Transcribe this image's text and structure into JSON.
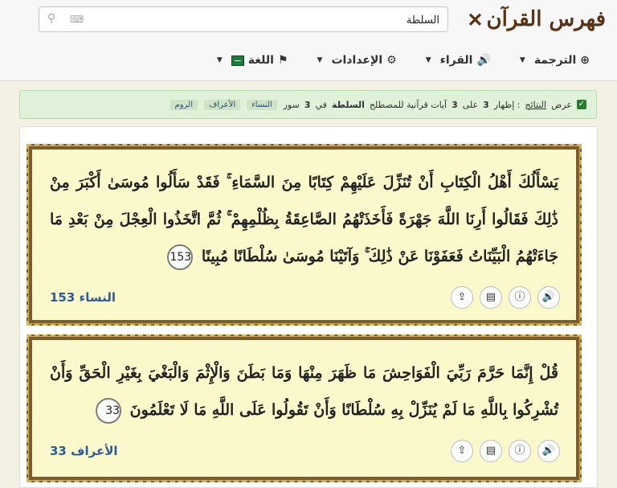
{
  "header": {
    "logo_text": "فهرس القرآن",
    "search_value": "السلطة"
  },
  "nav": [
    {
      "label": "الترجمة",
      "icon": "globe-icon"
    },
    {
      "label": "القراء",
      "icon": "speaker-icon"
    },
    {
      "label": "الإعدادات",
      "icon": "gear-icon"
    },
    {
      "label": "اللغة",
      "icon": "flag-icon"
    }
  ],
  "info": {
    "prefix": "عرض",
    "link": "النتائج",
    "middle": ": إظهار",
    "shown": "3",
    "on": "على",
    "total": "3",
    "middle2": "آيات قرآنية للمصطلح",
    "term": "السلطة",
    "in": "في",
    "suras_count": "3",
    "suras_word": "سور",
    "tags": [
      "النساء",
      "الأعراف",
      "الروم"
    ]
  },
  "verses": [
    {
      "text": "يَسْأَلُكَ أَهْلُ الْكِتَابِ أَنْ تُنَزِّلَ عَلَيْهِمْ كِتَابًا مِنَ السَّمَاءِ ۚ فَقَدْ سَأَلُوا مُوسَىٰ أَكْبَرَ مِنْ ذَٰلِكَ فَقَالُوا أَرِنَا اللَّهَ جَهْرَةً فَأَخَذَتْهُمُ الصَّاعِقَةُ بِظُلْمِهِمْ ۚ ثُمَّ اتَّخَذُوا الْعِجْلَ مِنْ بَعْدِ مَا جَاءَتْهُمُ الْبَيِّنَاتُ فَعَفَوْنَا عَنْ ذَٰلِكَ ۚ وَآتَيْنَا مُوسَىٰ سُلْطَانًا مُبِينًا",
      "number": "153",
      "reference": "النساء 153"
    },
    {
      "text": "قُلْ إِنَّمَا حَرَّمَ رَبِّيَ الْفَوَاحِشَ مَا ظَهَرَ مِنْهَا وَمَا بَطَنَ وَالْإِثْمَ وَالْبَغْيَ بِغَيْرِ الْحَقِّ وَأَنْ تُشْرِكُوا بِاللَّهِ مَا لَمْ يُنَزِّلْ بِهِ سُلْطَانًا وَأَنْ تَقُولُوا عَلَى اللَّهِ مَا لَا تَعْلَمُونَ",
      "number": "33",
      "reference": "الأعراف 33"
    }
  ],
  "action_icons": [
    "audio-icon",
    "info-icon",
    "pdf-icon",
    "share-icon"
  ]
}
